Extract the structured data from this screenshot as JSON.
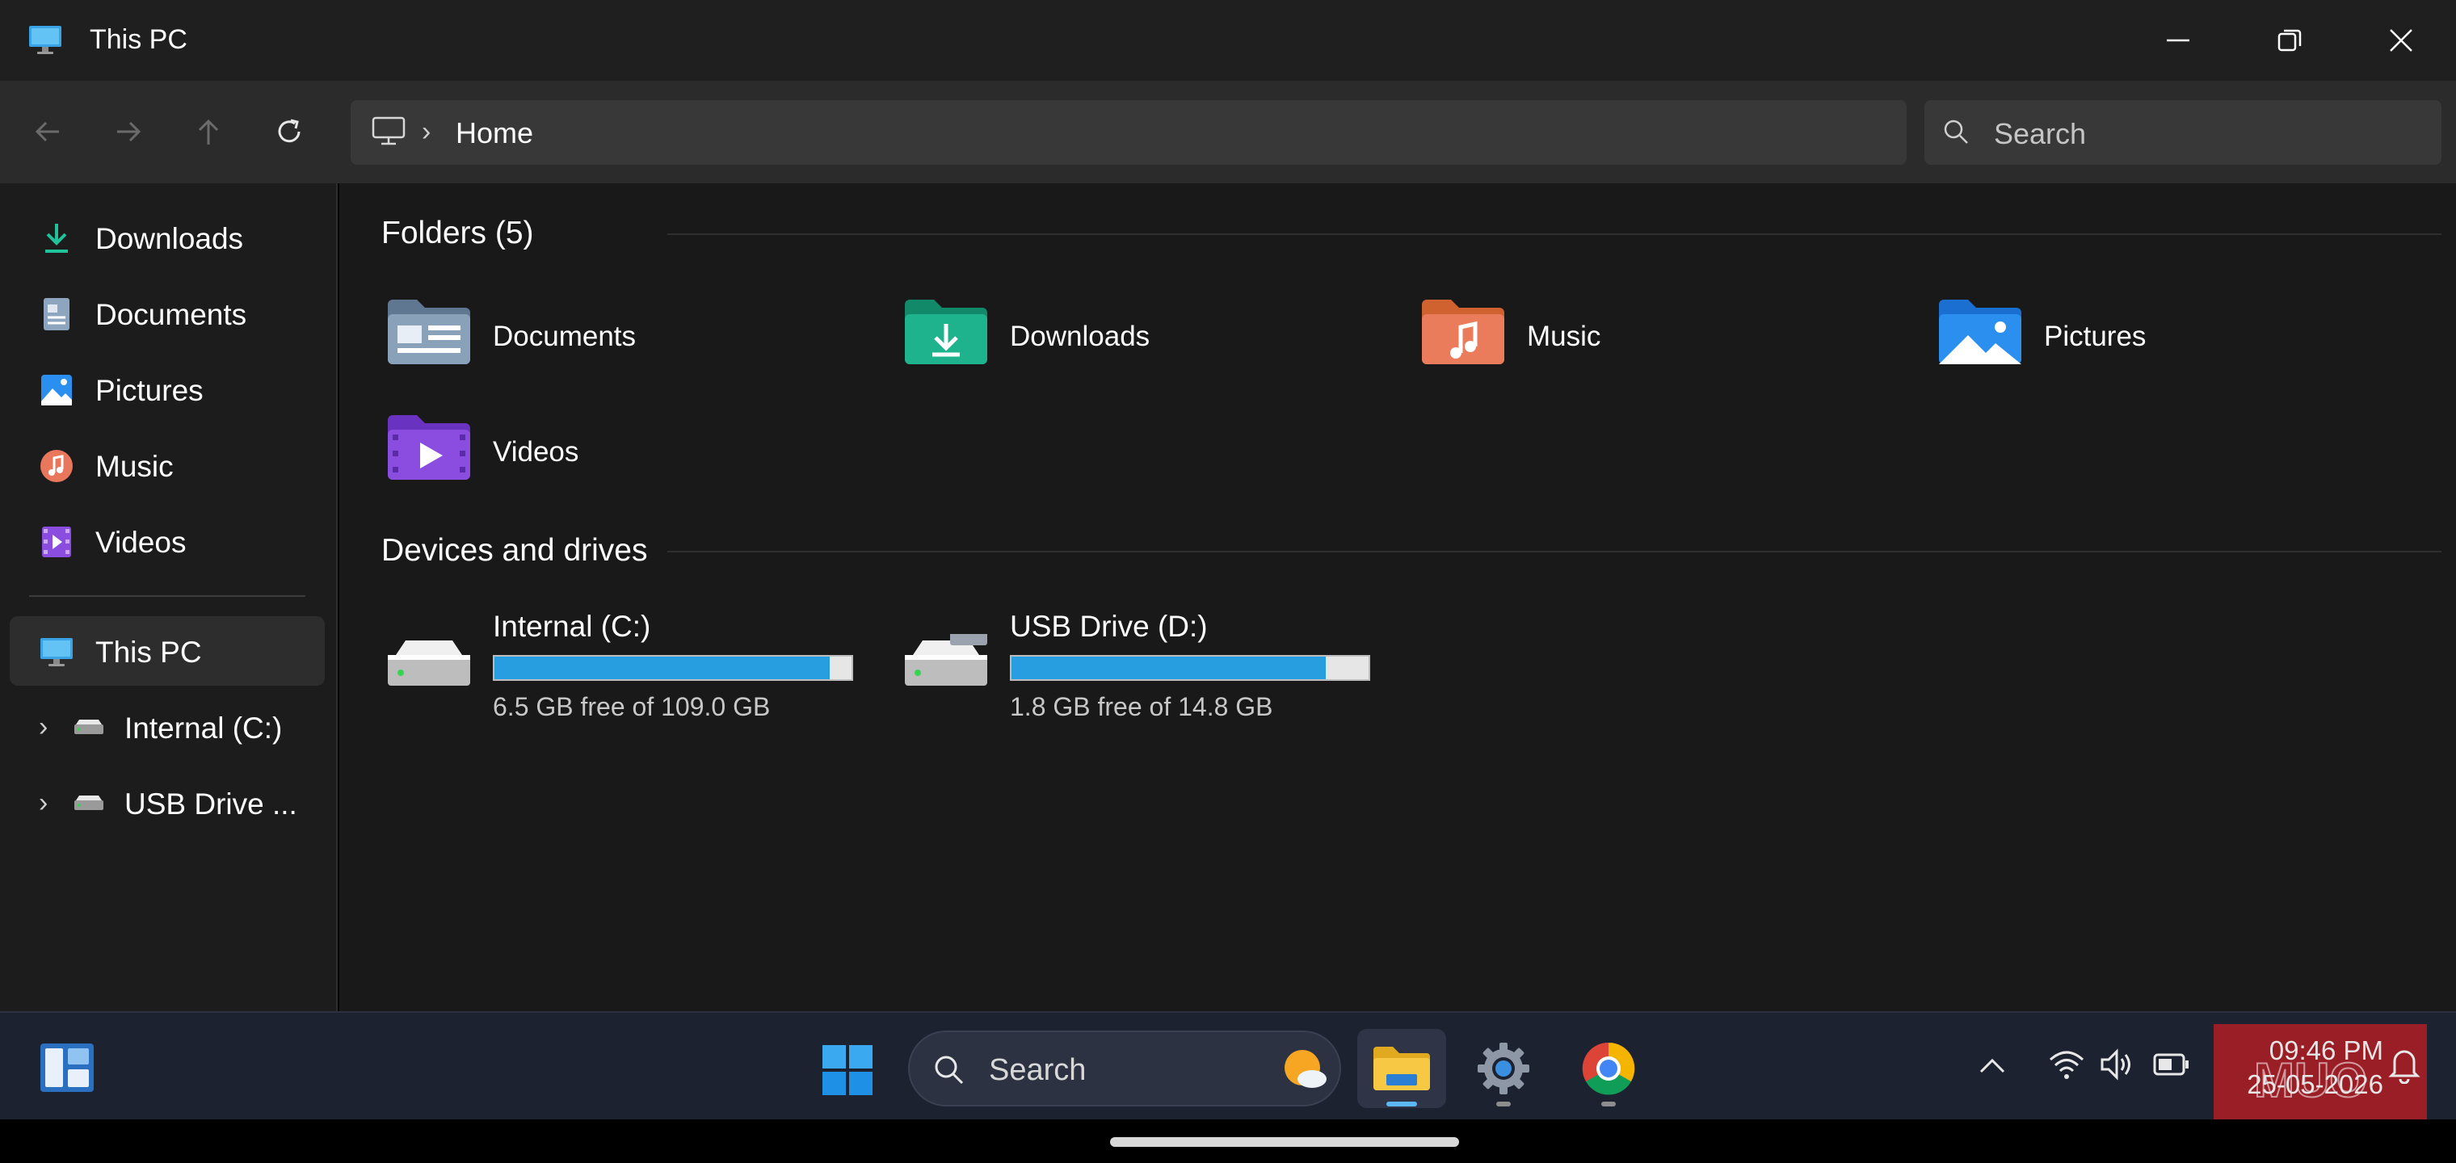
{
  "window": {
    "title": "This PC",
    "minimize_icon": "minimize-icon",
    "maximize_icon": "restore-icon",
    "close_icon": "close-icon"
  },
  "navbar": {
    "back_icon": "arrow-left-icon",
    "forward_icon": "arrow-right-icon",
    "up_icon": "arrow-up-icon",
    "refresh_icon": "refresh-icon",
    "address": {
      "icon": "monitor-icon",
      "separator": "›",
      "crumb": "Home"
    },
    "search_placeholder": "Search"
  },
  "sidebar": {
    "quick_access": [
      {
        "label": "Downloads",
        "icon": "download-icon"
      },
      {
        "label": "Documents",
        "icon": "document-icon"
      },
      {
        "label": "Pictures",
        "icon": "pictures-icon"
      },
      {
        "label": "Music",
        "icon": "music-icon"
      },
      {
        "label": "Videos",
        "icon": "video-icon"
      }
    ],
    "this_pc": {
      "label": "This PC",
      "icon": "monitor-icon",
      "selected": true
    },
    "drives": [
      {
        "label": "Internal (C:)",
        "icon": "drive-icon",
        "chevron": "›"
      },
      {
        "label": "USB Drive ...",
        "icon": "drive-icon",
        "chevron": "›"
      }
    ]
  },
  "content": {
    "folders_title": "Folders (5)",
    "folders": [
      {
        "label": "Documents",
        "icon": "documents-folder-icon",
        "color": "#7c93ad"
      },
      {
        "label": "Downloads",
        "icon": "downloads-folder-icon",
        "color": "#1fb38d"
      },
      {
        "label": "Music",
        "icon": "music-folder-icon",
        "color": "#e9775c"
      },
      {
        "label": "Pictures",
        "icon": "pictures-folder-icon",
        "color": "#2b8ff0"
      },
      {
        "label": "Videos",
        "icon": "videos-folder-icon",
        "color": "#8a4de0"
      }
    ],
    "drives_title": "Devices and drives",
    "drives": [
      {
        "name": "Internal (C:)",
        "info": "6.5 GB free of 109.0 GB",
        "used_fraction": 0.94,
        "icon": "hard-drive-icon"
      },
      {
        "name": "USB Drive (D:)",
        "info": "1.8 GB free of 14.8 GB",
        "used_fraction": 0.88,
        "icon": "usb-drive-icon"
      }
    ]
  },
  "taskbar": {
    "widgets_icon": "widgets-icon",
    "start_icon": "windows-start-icon",
    "search_placeholder": "Search",
    "weather_icon": "weather-icon",
    "apps": [
      {
        "name": "File Explorer",
        "icon": "file-explorer-icon",
        "active": true
      },
      {
        "name": "Settings",
        "icon": "settings-gear-icon",
        "active": false
      },
      {
        "name": "Chrome",
        "icon": "chrome-icon",
        "active": false
      }
    ],
    "tray": {
      "chevron_icon": "chevron-up-icon",
      "wifi_icon": "wifi-icon",
      "volume_icon": "volume-icon",
      "battery_icon": "battery-icon",
      "bell_icon": "bell-icon"
    },
    "time": "09:46 PM",
    "date": "25-05-2026",
    "watermark": "MUO",
    "accent": "#279edf"
  }
}
